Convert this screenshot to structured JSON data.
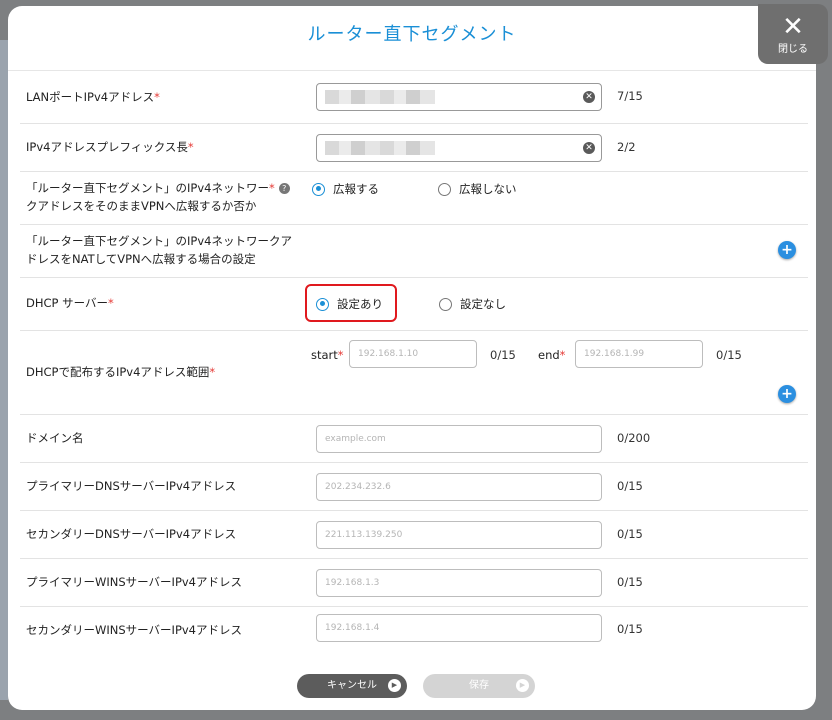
{
  "dialog": {
    "title": "ルーター直下セグメント",
    "close_label": "閉じる",
    "close_icon": "close-icon"
  },
  "fields": {
    "lan_ipv4": {
      "label": "LANポートIPv4アドレス",
      "required": "*",
      "counter": "7/15"
    },
    "prefix": {
      "label": "IPv4アドレスプレフィックス長",
      "required": "*",
      "counter": "2/2"
    },
    "advertise": {
      "label_line1": "「ルーター直下セグメント」のIPv4ネットワー",
      "label_line2": "クアドレスをそのままVPNへ広報するか否か",
      "required": "*",
      "help": "?",
      "option_yes": "広報する",
      "option_no": "広報しない",
      "selected": "広報する"
    },
    "nat": {
      "label_line1": "「ルーター直下セグメント」のIPv4ネットワークア",
      "label_line2": "ドレスをNATしてVPNへ広報する場合の設定"
    },
    "dhcp": {
      "label": "DHCP サーバー",
      "required": "*",
      "option_yes": "設定あり",
      "option_no": "設定なし",
      "selected": "設定あり"
    },
    "dhcp_range": {
      "label": "DHCPで配布するIPv4アドレス範囲",
      "required": "*",
      "start_label": "start",
      "start_placeholder": "192.168.1.10",
      "start_counter": "0/15",
      "end_label": "end",
      "end_placeholder": "192.168.1.99",
      "end_counter": "0/15"
    },
    "domain": {
      "label": "ドメイン名",
      "placeholder": "example.com",
      "counter": "0/200"
    },
    "primary_dns": {
      "label": "プライマリーDNSサーバーIPv4アドレス",
      "placeholder": "202.234.232.6",
      "counter": "0/15"
    },
    "secondary_dns": {
      "label": "セカンダリーDNSサーバーIPv4アドレス",
      "placeholder": "221.113.139.250",
      "counter": "0/15"
    },
    "primary_wins": {
      "label": "プライマリーWINSサーバーIPv4アドレス",
      "placeholder": "192.168.1.3",
      "counter": "0/15"
    },
    "secondary_wins": {
      "label": "セカンダリーWINSサーバーIPv4アドレス",
      "placeholder": "192.168.1.4",
      "counter": "0/15"
    }
  },
  "footer": {
    "cancel_label": "キャンセル",
    "save_label": "保存"
  },
  "colors": {
    "accent": "#1a8fd6",
    "required": "#e53935",
    "highlight": "#e0191e"
  }
}
